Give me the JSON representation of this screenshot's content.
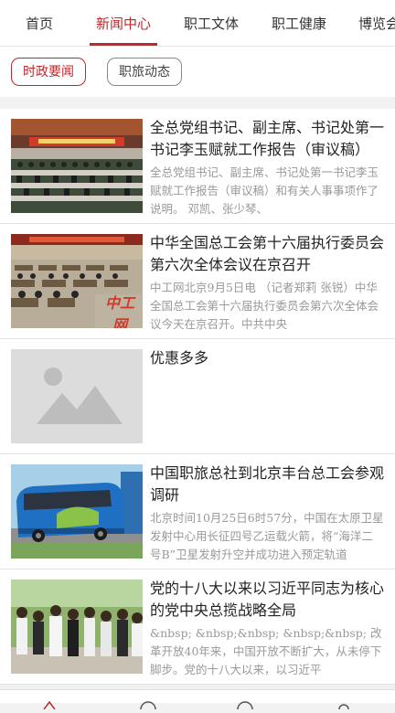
{
  "tabs": [
    {
      "label": "首页"
    },
    {
      "label": "新闻中心"
    },
    {
      "label": "职工文体"
    },
    {
      "label": "职工健康"
    },
    {
      "label": "博览会"
    }
  ],
  "active_tab": "新闻中心",
  "subtabs": [
    {
      "label": "时政要闻"
    },
    {
      "label": "职旅动态"
    }
  ],
  "active_subtab": "时政要闻",
  "news": [
    {
      "title": "全总党组书记、副主席、书记处第一书记李玉赋就工作报告（审议稿）",
      "summary": "全总党组书记、副主席、书记处第一书记李玉赋就工作报告（审议稿）和有关人事事项作了说明。 邓凯、张少琴、",
      "image": "meeting-hall-photo"
    },
    {
      "title": "中华全国总工会第十六届执行委员会第六次全体会议在京召开",
      "summary": "中工网北京9月5日电 （记者郑莉 张锐）中华全国总工会第十六届执行委员会第六次全体会议今天在京召开。中共中央",
      "image": "plenary-session-photo",
      "watermark": "中工网"
    },
    {
      "title": "优惠多多",
      "summary": "",
      "image": "image-placeholder"
    },
    {
      "title": "中国职旅总社到北京丰台总工会参观调研",
      "summary": "北京时间10月25日6时57分，中国在太原卫星发射中心用长征四号乙运载火箭，将“海洋二号B”卫星发射升空并成功进入预定轨道",
      "image": "tour-bus-photo"
    },
    {
      "title": "党的十八大以来以习近平同志为核心的党中央总揽战略全局",
      "summary": "&nbsp; &nbsp;&nbsp; &nbsp;&nbsp; 改革开放40年来，中国开放不断扩大，从未停下脚步。党的十八大以来，以习近平",
      "image": "officials-group-photo"
    }
  ],
  "bottom_nav": [
    {
      "icon": "home-icon"
    },
    {
      "icon": "compass-icon"
    },
    {
      "icon": "clock-icon"
    },
    {
      "icon": "user-icon"
    }
  ],
  "colors": {
    "accent": "#c0282d"
  }
}
